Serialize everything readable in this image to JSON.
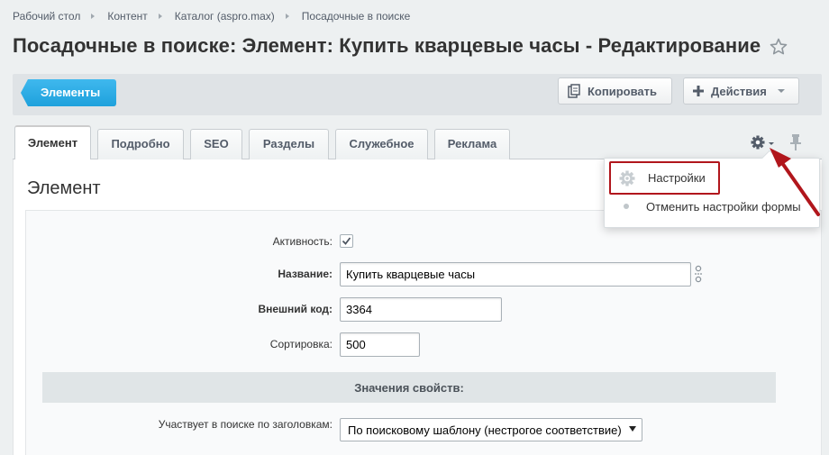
{
  "breadcrumb": [
    "Рабочий стол",
    "Контент",
    "Каталог (aspro.max)",
    "Посадочные в поиске"
  ],
  "page_title": "Посадочные в поиске: Элемент: Купить кварцевые часы - Редактирование",
  "toolbar": {
    "elements_label": "Элементы",
    "copy_label": "Копировать",
    "actions_label": "Действия"
  },
  "tabs": [
    "Элемент",
    "Подробно",
    "SEO",
    "Разделы",
    "Служебное",
    "Реклама"
  ],
  "active_tab": "Элемент",
  "settings_menu": {
    "items": [
      "Настройки",
      "Отменить настройки формы"
    ],
    "highlight_color": "#b1161c"
  },
  "section_title": "Элемент",
  "form": {
    "active_label": "Активность:",
    "active_checked": true,
    "name_label": "Название:",
    "name_value": "Купить кварцевые часы",
    "external_code_label": "Внешний код:",
    "external_code_value": "3364",
    "sort_label": "Сортировка:",
    "sort_value": "500"
  },
  "properties": {
    "header": "Значения свойств:",
    "search_label": "Участвует в поиске по заголовкам:",
    "search_value": "По поисковому шаблону (нестрогое соответствие)"
  },
  "colors": {
    "accent_blue": "#1ea1dc",
    "annotation_red": "#b1161c"
  },
  "icons": [
    "star-icon",
    "copy-icon",
    "plus-icon",
    "gear-icon",
    "pin-icon",
    "translit-icon",
    "checkmark-icon"
  ]
}
